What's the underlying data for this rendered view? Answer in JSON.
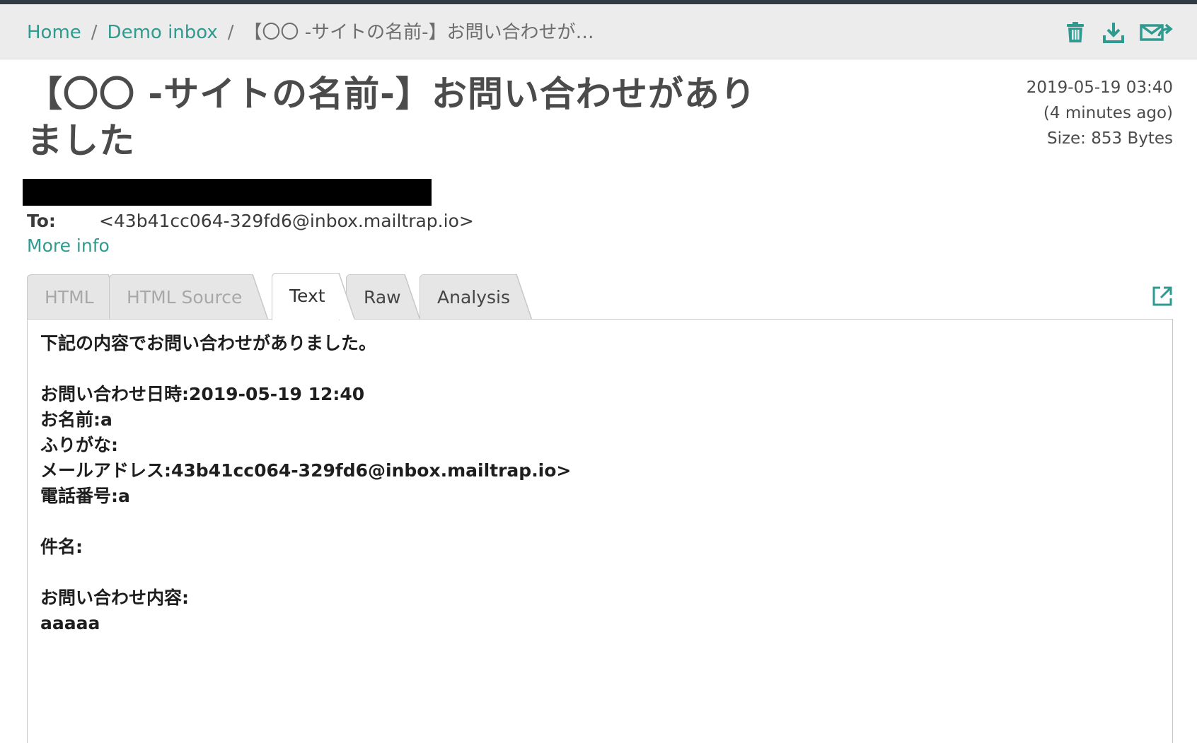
{
  "breadcrumb": {
    "home": "Home",
    "inbox": "Demo inbox",
    "current": "【〇〇 -サイトの名前-】お問い合わせがあ…"
  },
  "actions": {
    "icons": [
      "trash-icon",
      "download-icon",
      "forward-icon"
    ]
  },
  "message": {
    "subject": "【〇〇 -サイトの名前-】お問い合わせがありました",
    "date": "2019-05-19 03:40",
    "relative": "(4 minutes ago)",
    "size": "Size: 853 Bytes",
    "to_label": "To:",
    "to_value": "<43b41cc064-329fd6@inbox.mailtrap.io>",
    "more_info": "More info"
  },
  "tabs": [
    {
      "label": "HTML",
      "state": "disabled"
    },
    {
      "label": "HTML Source",
      "state": "disabled"
    },
    {
      "label": "Text",
      "state": "active"
    },
    {
      "label": "Raw",
      "state": "normal"
    },
    {
      "label": "Analysis",
      "state": "normal"
    }
  ],
  "body": {
    "text": "下記の内容でお問い合わせがありました。\n\nお問い合わせ日時:2019-05-19 12:40\nお名前:a\nふりがな:\nメールアドレス:43b41cc064-329fd6@inbox.mailtrap.io>\n電話番号:a\n\n件名:\n\nお問い合わせ内容:\naaaaa"
  },
  "colors": {
    "accent": "#2f9a8f",
    "header_bg": "#ececec",
    "top_strip": "#2f3a44"
  }
}
